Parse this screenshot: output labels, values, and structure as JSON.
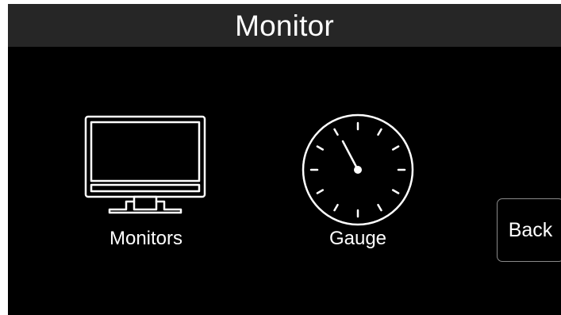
{
  "header": {
    "title": "Monitor"
  },
  "tiles": [
    {
      "label": "Monitors",
      "icon": "monitor-icon"
    },
    {
      "label": "Gauge",
      "icon": "gauge-icon"
    }
  ],
  "back_button": {
    "label": "Back"
  },
  "colors": {
    "background": "#000000",
    "header": "#262626",
    "icon_stroke": "#ffffff",
    "text": "#ffffff",
    "button_border": "#8a8a8a"
  }
}
